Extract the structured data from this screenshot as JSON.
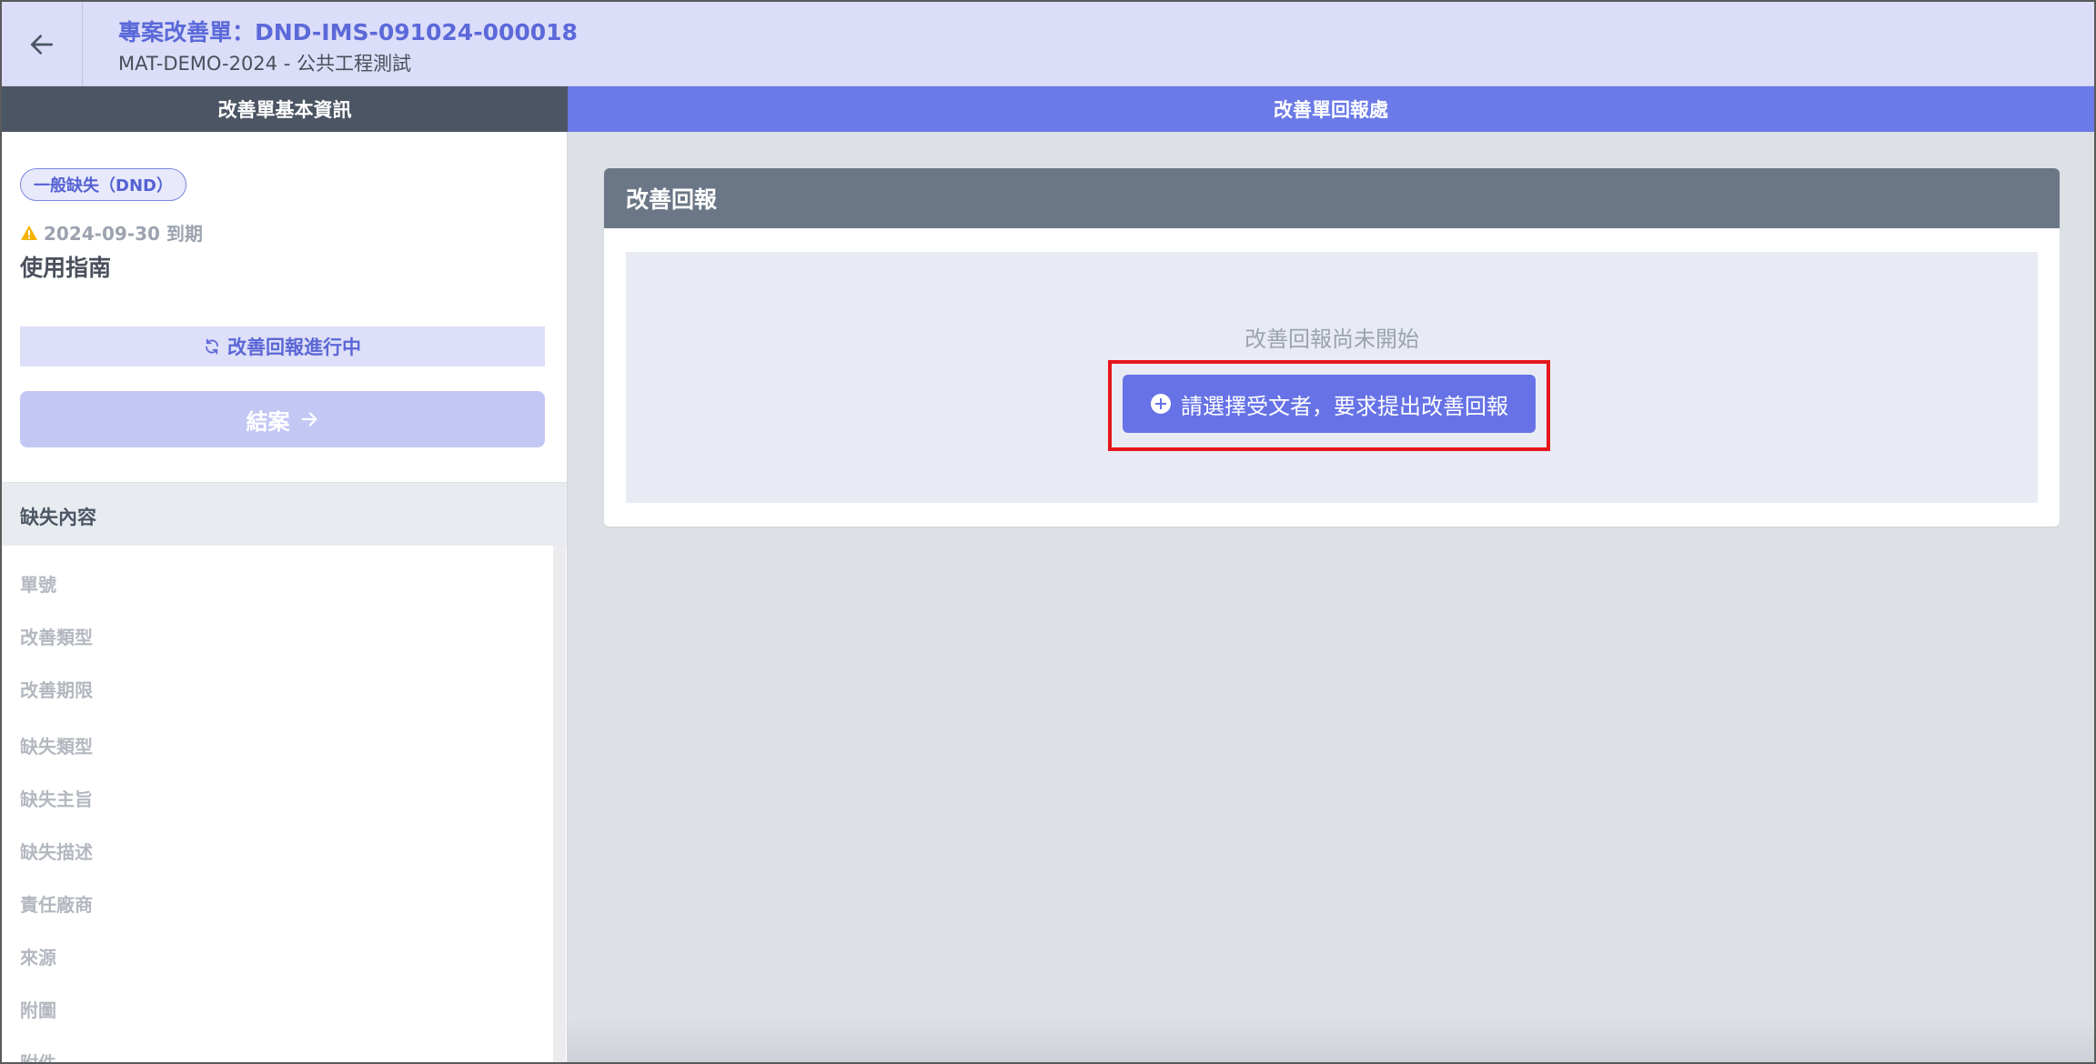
{
  "header": {
    "title": "專案改善單：DND-IMS-091024-000018",
    "subtitle": "MAT-DEMO-2024 - 公共工程測試"
  },
  "tabs": {
    "left": "改善單基本資訊",
    "right": "改善單回報處"
  },
  "info": {
    "badge": "一般缺失（DND）",
    "due": "2024-09-30 到期",
    "title": "使用指南",
    "status": "改善回報進行中",
    "close_label": "結案"
  },
  "section": {
    "title": "缺失內容",
    "fields": [
      "單號",
      "改善類型",
      "改善期限",
      "缺失類型",
      "缺失主旨",
      "缺失描述",
      "責任廠商",
      "來源",
      "附圖",
      "附件"
    ]
  },
  "report": {
    "card_title": "改善回報",
    "empty_text": "改善回報尚未開始",
    "request_label": "請選擇受文者，要求提出改善回報"
  },
  "colors": {
    "accent": "#6672e6",
    "header_bg": "#dcddf8",
    "highlight": "#e5161b",
    "warning": "#f5b301"
  }
}
